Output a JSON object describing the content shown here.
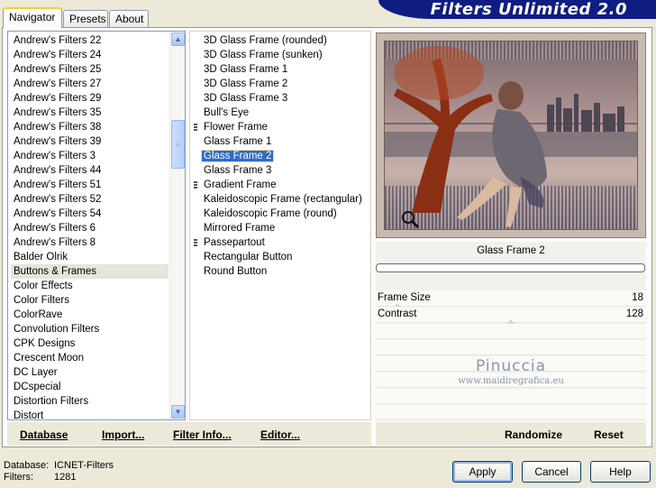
{
  "banner": {
    "title": "Filters Unlimited 2.0"
  },
  "tabs": [
    {
      "label": "Navigator",
      "active": true
    },
    {
      "label": "Presets",
      "active": false
    },
    {
      "label": "About",
      "active": false
    }
  ],
  "categories": {
    "items": [
      "Andrew's Filters 22",
      "Andrew's Filters 24",
      "Andrew's Filters 25",
      "Andrew's Filters 27",
      "Andrew's Filters 29",
      "Andrew's Filters 35",
      "Andrew's Filters 38",
      "Andrew's Filters 39",
      "Andrew's Filters 3",
      "Andrew's Filters 44",
      "Andrew's Filters 51",
      "Andrew's Filters 52",
      "Andrew's Filters 54",
      "Andrew's Filters 6",
      "Andrew's Filters 8",
      "Balder Olrik",
      "Buttons & Frames",
      "Color Effects",
      "Color Filters",
      "ColorRave",
      "Convolution Filters",
      "CPK Designs",
      "Crescent Moon",
      "DC Layer",
      "DCspecial",
      "Distortion Filters",
      "Distort"
    ],
    "selected": "Buttons & Frames"
  },
  "filters": {
    "items": [
      {
        "label": "3D Glass Frame (rounded)",
        "group": false
      },
      {
        "label": "3D Glass Frame (sunken)",
        "group": false
      },
      {
        "label": "3D Glass Frame 1",
        "group": false
      },
      {
        "label": "3D Glass Frame 2",
        "group": false
      },
      {
        "label": "3D Glass Frame 3",
        "group": false
      },
      {
        "label": "Bull's Eye",
        "group": false
      },
      {
        "label": "Flower Frame",
        "group": true
      },
      {
        "label": "Glass Frame 1",
        "group": false
      },
      {
        "label": "Glass Frame 2",
        "group": false
      },
      {
        "label": "Glass Frame 3",
        "group": false
      },
      {
        "label": "Gradient Frame",
        "group": true
      },
      {
        "label": "Kaleidoscopic Frame (rectangular)",
        "group": false
      },
      {
        "label": "Kaleidoscopic Frame (round)",
        "group": false
      },
      {
        "label": "Mirrored Frame",
        "group": false
      },
      {
        "label": "Passepartout",
        "group": true
      },
      {
        "label": "Rectangular Button",
        "group": false
      },
      {
        "label": "Round Button",
        "group": false
      }
    ],
    "selected": "Glass Frame 2"
  },
  "preview": {
    "filter_name": "Glass Frame 2"
  },
  "params": [
    {
      "label": "Frame Size",
      "value": "18",
      "level": 0.07
    },
    {
      "label": "Contrast",
      "value": "128",
      "level": 0.5
    }
  ],
  "watermark": {
    "name": "Pinuccia",
    "url": "www.maidiregrafica.eu"
  },
  "toolbar_left": {
    "database": "Database",
    "import": "Import...",
    "filter_info": "Filter Info...",
    "editor": "Editor..."
  },
  "toolbar_right": {
    "randomize": "Randomize",
    "reset": "Reset"
  },
  "footer": {
    "database_label": "Database:",
    "database_value": "ICNET-Filters",
    "filters_label": "Filters:",
    "filters_value": "1281"
  },
  "buttons": {
    "apply": "Apply",
    "cancel": "Cancel",
    "help": "Help"
  },
  "colors": {
    "banner": "#0f1d80",
    "selection": "#316ac5"
  }
}
